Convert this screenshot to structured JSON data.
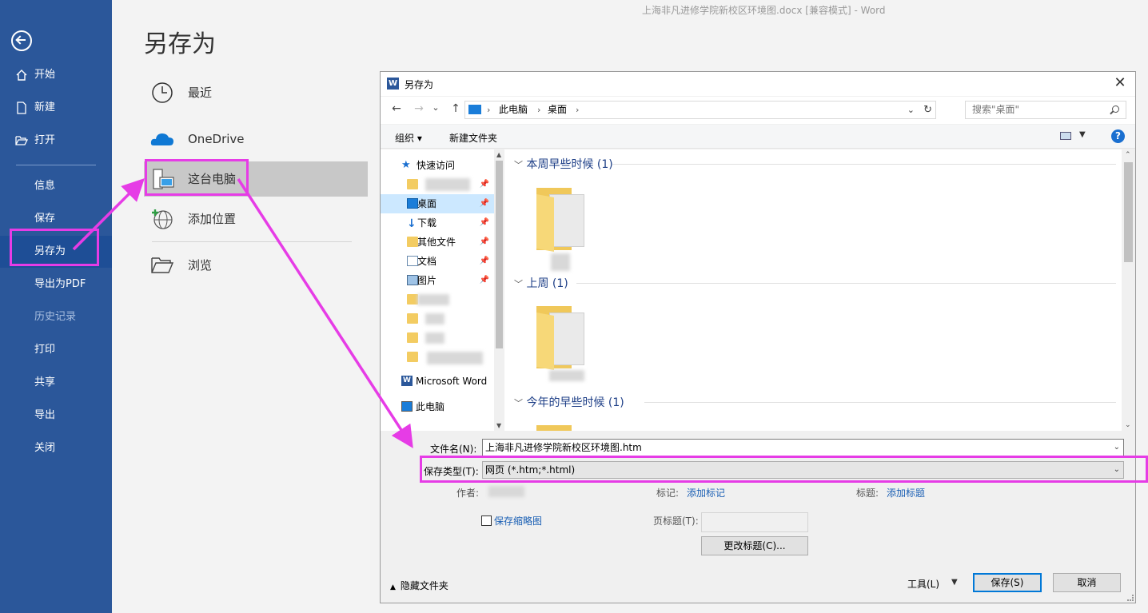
{
  "window_title": "上海非凡进修学院新校区环境图.docx [兼容模式]  -  Word",
  "backstage": {
    "title": "另存为",
    "nav": [
      {
        "label": "开始",
        "icon": "home-icon"
      },
      {
        "label": "新建",
        "icon": "new-doc-icon"
      },
      {
        "label": "打开",
        "icon": "open-folder-icon"
      },
      {
        "label": "信息"
      },
      {
        "label": "保存"
      },
      {
        "label": "另存为"
      },
      {
        "label": "导出为PDF"
      },
      {
        "label": "历史记录"
      },
      {
        "label": "打印"
      },
      {
        "label": "共享"
      },
      {
        "label": "导出"
      },
      {
        "label": "关闭"
      }
    ],
    "locations": [
      {
        "label": "最近",
        "icon": "clock-icon"
      },
      {
        "label": "OneDrive",
        "icon": "cloud-icon"
      },
      {
        "label": "这台电脑",
        "icon": "computer-icon"
      },
      {
        "label": "添加位置",
        "icon": "globe-add-icon"
      },
      {
        "label": "浏览",
        "icon": "folder-open-icon"
      }
    ]
  },
  "dialog": {
    "title": "另存为",
    "close_glyph": "✕",
    "nav_glyphs": {
      "back": "←",
      "forward": "→",
      "recent": "⌄",
      "up": "↑"
    },
    "breadcrumb": [
      "此电脑",
      "桌面"
    ],
    "search_placeholder": "搜索\"桌面\"",
    "toolbar": {
      "organize": "组织 ▾",
      "new_folder": "新建文件夹",
      "help": "?"
    },
    "tree": [
      {
        "label": "快速访问",
        "icon": "star-icon"
      },
      {
        "label": "",
        "icon": "folder-icon",
        "pinned": true
      },
      {
        "label": "桌面",
        "icon": "desktop-icon",
        "pinned": true,
        "selected": true
      },
      {
        "label": "下载",
        "icon": "download-icon",
        "pinned": true
      },
      {
        "label": "其他文件",
        "icon": "folder-icon",
        "pinned": true
      },
      {
        "label": "文档",
        "icon": "documents-icon",
        "pinned": true
      },
      {
        "label": "图片",
        "icon": "pictures-icon",
        "pinned": true
      },
      {
        "label": "",
        "icon": "folder-icon"
      },
      {
        "label": "",
        "icon": "folder-icon"
      },
      {
        "label": "",
        "icon": "folder-icon"
      },
      {
        "label": "",
        "icon": "folder-icon"
      },
      {
        "label": "Microsoft Word",
        "icon": "word-icon"
      },
      {
        "label": "此电脑",
        "icon": "pc-icon"
      }
    ],
    "groups": [
      {
        "label": "本周早些时候 (1)"
      },
      {
        "label": "上周 (1)"
      },
      {
        "label": "今年的早些时候 (1)"
      }
    ],
    "file_name_label": "文件名(N):",
    "file_name": "上海非凡进修学院新校区环境图.htm",
    "save_type_label": "保存类型(T):",
    "save_type": "网页 (*.htm;*.html)",
    "author_label": "作者:",
    "tags_label": "标记:",
    "tags_link": "添加标记",
    "title_label": "标题:",
    "title_link": "添加标题",
    "thumbnail_label": "保存缩略图",
    "page_title_label": "页标题(T):",
    "change_title_button": "更改标题(C)...",
    "hide_folders": "隐藏文件夹",
    "tools": "工具(L)",
    "save_button": "保存(S)",
    "cancel_button": "取消"
  },
  "colors": {
    "nav_bg": "#2b579a",
    "annotation": "#e63ce6",
    "selection": "#cce8ff"
  }
}
